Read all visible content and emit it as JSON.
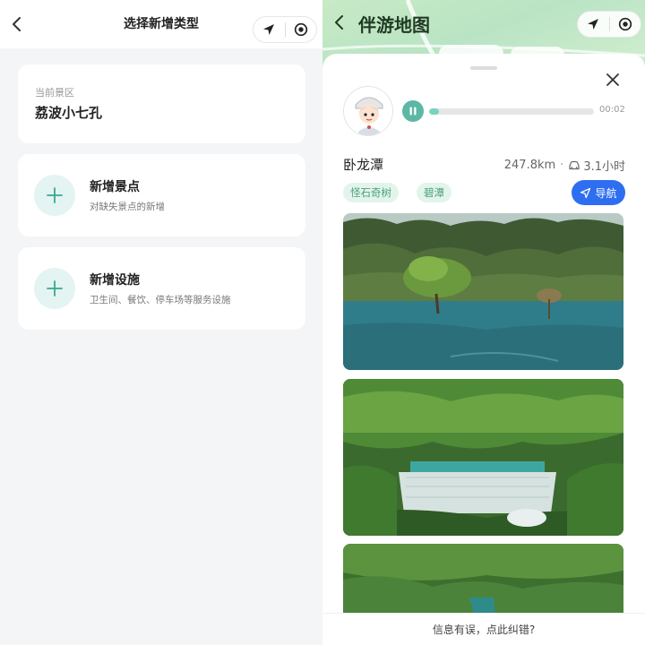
{
  "left": {
    "header": {
      "title": "选择新增类型"
    },
    "current": {
      "label": "当前景区",
      "value": "荔波小七孔"
    },
    "options": [
      {
        "title": "新增景点",
        "desc": "对缺失景点的新增"
      },
      {
        "title": "新增设施",
        "desc": "卫生间、餐饮、停车场等服务设施"
      }
    ]
  },
  "right": {
    "header": {
      "title": "伴游地图"
    },
    "audio": {
      "time": "00:02",
      "progress": 0.06
    },
    "spot": {
      "name": "卧龙潭",
      "distance": "247.8km",
      "separator": "·",
      "duration": "3.1小时",
      "tags": [
        "怪石奇树",
        "碧潭"
      ],
      "nav_label": "导航"
    },
    "footer": {
      "text": "信息有误，点此纠错?"
    }
  },
  "colors": {
    "accent_teal": "#5cb8a4",
    "nav_blue": "#2e6ff1",
    "tag_green": "#4aa37a",
    "page_bg": "#f4f5f7"
  },
  "icons": [
    "chevron-left-icon",
    "location-arrow-icon",
    "target-icon",
    "plus-icon",
    "close-icon",
    "pause-icon",
    "car-icon",
    "navigation-icon"
  ]
}
